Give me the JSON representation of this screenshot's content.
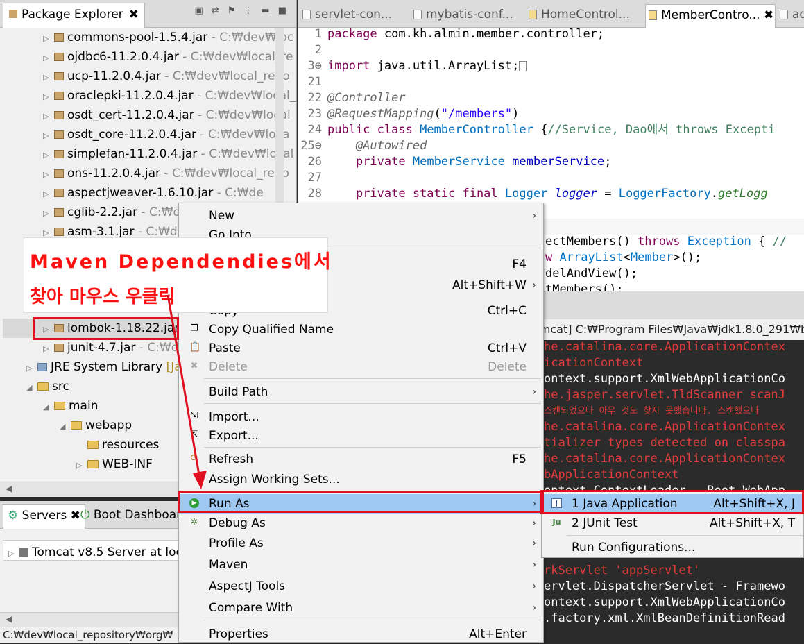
{
  "package_explorer": {
    "tab_title": "Package Explorer",
    "tab_close": "✖",
    "rows": [
      {
        "name": "commons-pool-1.5.4.jar",
        "path": " - C:₩dev₩loc"
      },
      {
        "name": "ojdbc6-11.2.0.4.jar",
        "path": " - C:₩dev₩local_re"
      },
      {
        "name": "ucp-11.2.0.4.jar",
        "path": " - C:₩dev₩local_repo"
      },
      {
        "name": "oraclepki-11.2.0.4.jar",
        "path": " - C:₩dev₩local_"
      },
      {
        "name": "osdt_cert-11.2.0.4.jar",
        "path": " - C:₩dev₩local"
      },
      {
        "name": "osdt_core-11.2.0.4.jar",
        "path": " - C:₩dev₩loca"
      },
      {
        "name": "simplefan-11.2.0.4.jar",
        "path": " - C:₩dev₩local"
      },
      {
        "name": "ons-11.2.0.4.jar",
        "path": " - C:₩dev₩local_repo"
      },
      {
        "name": "aspectjweaver-1.6.10.jar",
        "path": " - C:₩de"
      },
      {
        "name": "cglib-2.2.jar",
        "path": " - C:₩de"
      },
      {
        "name": "asm-3.1.jar",
        "path": " - C:₩de"
      }
    ],
    "lombok": {
      "name": "lombok-1.18.22.jar",
      "path": ""
    },
    "junit": {
      "name": "junit-4.7.jar",
      "path": " - C:₩de"
    },
    "jre": {
      "name": "JRE System Library",
      "path": " [Ja"
    },
    "src": "src",
    "main": "main",
    "webapp": "webapp",
    "resources": "resources",
    "webinf": "WEB-INF"
  },
  "servers": {
    "tab_servers": "Servers",
    "tab_boot": "Boot Dashboar",
    "server_row": "Tomcat v8.5 Server at loc"
  },
  "status_bar": "C:₩dev₩local_repository₩org₩",
  "editor": {
    "tabs": [
      "servlet-con...",
      "mybatis-conf...",
      "HomeControl...",
      "MemberContro...",
      "ad"
    ],
    "tab_close": "✖",
    "lines": [
      {
        "n": "1",
        "text": "package com.kh.almin.member.controller;"
      },
      {
        "n": "2",
        "text": ""
      },
      {
        "n": "3⊕",
        "text": "import java.util.ArrayList;□"
      },
      {
        "n": "21",
        "text": ""
      },
      {
        "n": "22",
        "text": "@Controller"
      },
      {
        "n": "23",
        "text": "@RequestMapping(\"/members\")"
      },
      {
        "n": "24",
        "text": "public class MemberController {//Service, Dao에서 throws Excepti"
      },
      {
        "n": "25⊖",
        "text": "    @Autowired"
      },
      {
        "n": "26",
        "text": "    private MemberService memberService;"
      },
      {
        "n": "27",
        "text": ""
      },
      {
        "n": "28",
        "text": "    private static final Logger logger = LoggerFactory.getLogg"
      }
    ],
    "hidden_lines": [
      "ectMembers() throws Exception { //",
      "w ArrayList<Member>();",
      "delAndView();",
      "tMembers();"
    ]
  },
  "console": {
    "header": "omcat] C:₩Program Files₩Java₩jdk1.8.0_291₩b",
    "lines": [
      {
        "t": "he.catalina.core.ApplicationContex",
        "red": true
      },
      {
        "t": "icationContext",
        "red": true
      },
      {
        "t": "ontext.support.XmlWebApplicationCo",
        "red": false
      },
      {
        "t": "he.jasper.servlet.TldScanner scanJ",
        "red": true
      },
      {
        "t": "스캔되었으나 아무 것도 찾지 못했습니다. 스캔했으나 ",
        "red": true
      },
      {
        "t": "he.catalina.core.ApplicationContex",
        "red": true
      },
      {
        "t": "tializer types detected on classpa",
        "red": true
      },
      {
        "t": "he.catalina.core.ApplicationContex",
        "red": true
      },
      {
        "t": "bApplicationContext",
        "red": true
      },
      {
        "t": "ontext.ContextLoader - Root WebApp",
        "red": false
      },
      {
        "t": "rkServlet 'appServlet'",
        "red": true
      },
      {
        "t": "ervlet.DispatcherServlet - Framewo",
        "red": false
      },
      {
        "t": "ontext.support.XmlWebApplicationCo",
        "red": false
      },
      {
        "t": ".factory.xml.XmlBeanDefinitionRead",
        "red": false
      }
    ]
  },
  "context_menu": {
    "new": "New",
    "go_into": "Go Into",
    "f4": "F4",
    "show_in": "Alt+Shift+W",
    "copy": "Copy",
    "copy_sc": "Ctrl+C",
    "copy_qn": "Copy Qualified Name",
    "paste": "Paste",
    "paste_sc": "Ctrl+V",
    "delete": "Delete",
    "delete_sc": "Delete",
    "build_path": "Build Path",
    "import": "Import...",
    "export": "Export...",
    "refresh": "Refresh",
    "refresh_sc": "F5",
    "assign": "Assign Working Sets...",
    "run_as": "Run As",
    "debug_as": "Debug As",
    "profile_as": "Profile As",
    "maven": "Maven",
    "aspectj": "AspectJ Tools",
    "compare": "Compare With",
    "properties": "Properties",
    "properties_sc": "Alt+Enter"
  },
  "submenu": {
    "java_app": "1 Java Application",
    "java_app_sc": "Alt+Shift+X, J",
    "junit": "2 JUnit Test",
    "junit_sc": "Alt+Shift+X, T",
    "run_configs": "Run Configurations..."
  },
  "annotation": {
    "line1": "Maven Dependendies에서",
    "line2": "찾아 마우스 우클릭"
  },
  "colors": {
    "highlight": "#9ec8f2",
    "annotation_red": "#e01020"
  }
}
